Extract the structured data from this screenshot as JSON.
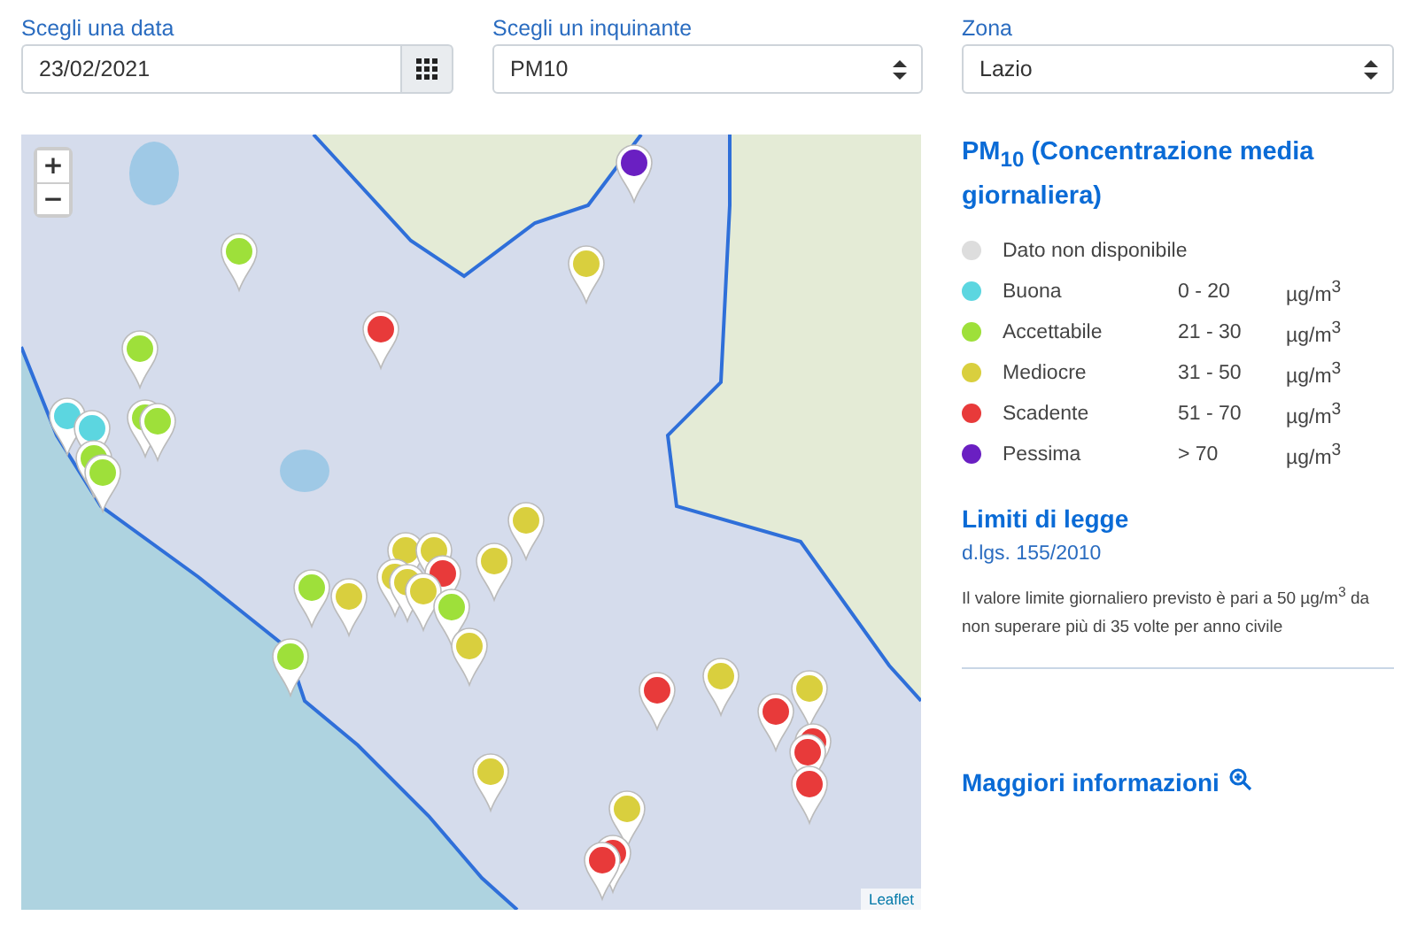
{
  "filters": [
    {
      "label": "Scegli una data",
      "kind": "date",
      "value": "23/02/2021"
    },
    {
      "label": "Scegli un inquinante",
      "kind": "select",
      "value": "PM10"
    },
    {
      "label": "Zona",
      "kind": "select",
      "value": "Lazio"
    }
  ],
  "map": {
    "zoom_controls": [
      "+",
      "−"
    ],
    "attribution": "Leaflet"
  },
  "legend": {
    "title": "PM$_{10}$ (Concentrazione media giornaliera)",
    "items": [
      {
        "label": "Dato non disponibile",
        "color": "#dddddd"
      },
      {
        "label": "Buona",
        "range": "0 - 20",
        "unit": "µg/m$^{3}$",
        "color": "#5cd6e0"
      },
      {
        "label": "Accettabile",
        "range": "21 - 30",
        "unit": "µg/m$^{3}$",
        "color": "#9ee03a"
      },
      {
        "label": "Mediocre",
        "range": "31 - 50",
        "unit": "µg/m$^{3}$",
        "color": "#d9cf3e"
      },
      {
        "label": "Scadente",
        "range": "51 - 70",
        "unit": "µg/m$^{3}$",
        "color": "#e83a3a"
      },
      {
        "label": "Pessima",
        "range": "> 70",
        "unit": "µg/m$^{3}$",
        "color": "#6a1fc2"
      }
    ]
  },
  "limits": {
    "title": "Limiti di legge",
    "law": "d.lgs. 155/2010",
    "text": "Il valore limite giornaliero previsto è pari a 50 µg/m$^{3}$ da non superare più di 35 volte per anno civile"
  },
  "more_info": "Maggiori informazioni"
}
